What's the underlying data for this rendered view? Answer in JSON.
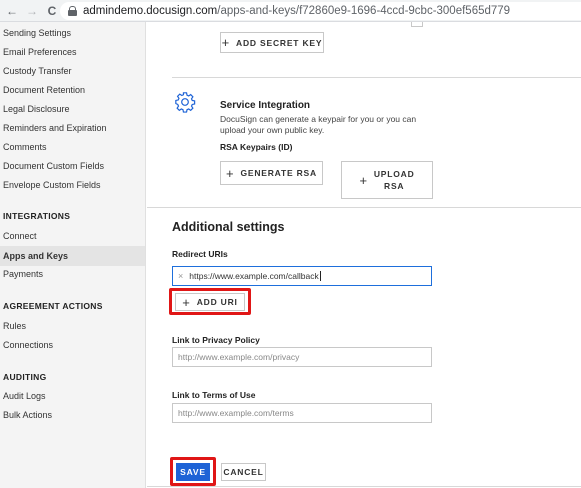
{
  "browser": {
    "back": "←",
    "forward": "→",
    "reload": "C",
    "url_host": "admindemo.docusign.com",
    "url_path": "/apps-and-keys/f72860e9-1696-4ccd-9cbc-300ef565d779"
  },
  "sidebar": {
    "items_top": [
      "Sending Settings",
      "Email Preferences",
      "Custody Transfer",
      "Document Retention",
      "Legal Disclosure",
      "Reminders and Expiration",
      "Comments",
      "Document Custom Fields",
      "Envelope Custom Fields"
    ],
    "integrations_heading": "INTEGRATIONS",
    "integrations": [
      "Connect",
      "Apps and Keys",
      "Payments"
    ],
    "agreement_heading": "AGREEMENT ACTIONS",
    "agreement": [
      "Rules",
      "Connections"
    ],
    "auditing_heading": "AUDITING",
    "auditing": [
      "Audit Logs",
      "Bulk Actions"
    ]
  },
  "main": {
    "add_secret_key": "ADD SECRET KEY",
    "service_integration": {
      "title": "Service Integration",
      "description_line1": "DocuSign can generate a keypair for you or you can",
      "description_line2": "upload your own public key.",
      "rsa_label": "RSA Keypairs (ID)",
      "generate_rsa": "GENERATE RSA",
      "upload_rsa_line1": "UPLOAD",
      "upload_rsa_line2": "RSA"
    },
    "additional": {
      "heading": "Additional settings",
      "redirect_label": "Redirect URIs",
      "redirect_value": "https://www.example.com/callback",
      "add_uri": "ADD URI",
      "privacy_label": "Link to Privacy Policy",
      "privacy_placeholder": "http://www.example.com/privacy",
      "terms_label": "Link to Terms of Use",
      "terms_placeholder": "http://www.example.com/terms"
    },
    "save": "SAVE",
    "cancel": "CANCEL"
  },
  "colors": {
    "primary": "#1e63d6",
    "highlight": "#e01616",
    "gear_icon": "#1e63d6"
  },
  "icons": [
    "back-arrow-icon",
    "forward-arrow-icon",
    "reload-icon",
    "lock-icon",
    "gear-icon",
    "plus-icon",
    "clear-icon"
  ]
}
